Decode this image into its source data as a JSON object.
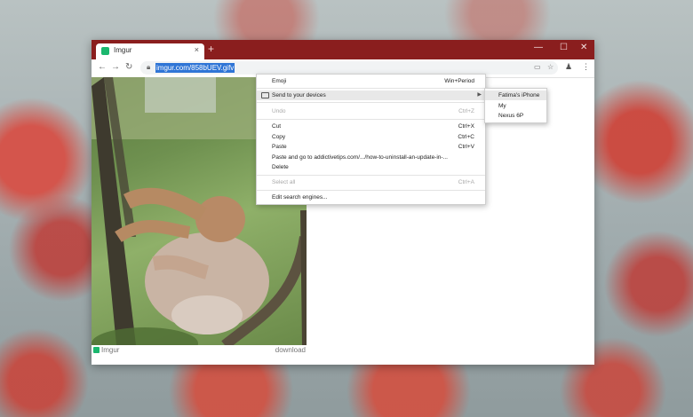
{
  "tab": {
    "title": "Imgur",
    "close": "×",
    "new_tab": "+"
  },
  "window": {
    "minimize": "—",
    "maximize": "☐",
    "close": "✕"
  },
  "nav": {
    "back": "←",
    "forward": "→",
    "reload": "↻"
  },
  "omnibox": {
    "url": "imgur.com/858bUEV.gifv"
  },
  "caption": {
    "site": "Imgur",
    "link": "download"
  },
  "context_menu": {
    "items": [
      {
        "label": "Emoji",
        "shortcut": "Win+Period",
        "disabled": false
      },
      {
        "label": "Send to your devices",
        "shortcut": "",
        "submenu": true
      },
      {
        "label": "Undo",
        "shortcut": "Ctrl+Z",
        "disabled": true
      },
      {
        "label": "Cut",
        "shortcut": "Ctrl+X",
        "disabled": false
      },
      {
        "label": "Copy",
        "shortcut": "Ctrl+C",
        "disabled": false
      },
      {
        "label": "Paste",
        "shortcut": "Ctrl+V",
        "disabled": false
      },
      {
        "label": "Paste and go to addictivetips.com/.../how-to-uninstall-an-update-in-...",
        "shortcut": ""
      },
      {
        "label": "Delete",
        "shortcut": ""
      },
      {
        "label": "Select all",
        "shortcut": "Ctrl+A",
        "disabled": true
      },
      {
        "label": "Edit search engines...",
        "shortcut": ""
      }
    ],
    "submenu": [
      "Fatima's iPhone",
      "My",
      "Nexus 6P"
    ]
  },
  "colors": {
    "titlebar": "#8a1e1e",
    "url_highlight": "#2f75d6",
    "imgur_green": "#1bb76e"
  }
}
